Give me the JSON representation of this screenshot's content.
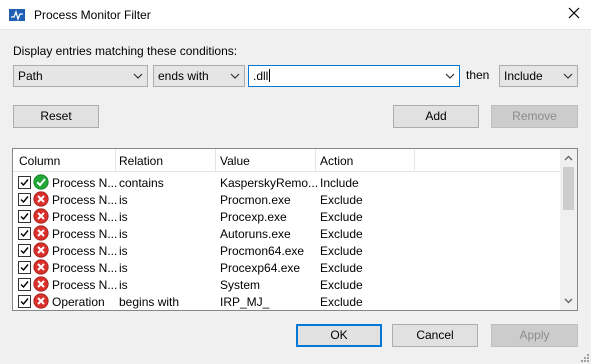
{
  "window": {
    "title": "Process Monitor Filter",
    "close_icon": "close-icon",
    "app_icon": "process-monitor-icon"
  },
  "condition": {
    "label": "Display entries matching these conditions:",
    "column_value": "Path",
    "relation_value": "ends with",
    "value_text": ".dll",
    "then_label": "then",
    "action_value": "Include"
  },
  "buttons": {
    "reset": "Reset",
    "add": "Add",
    "remove": "Remove",
    "ok": "OK",
    "cancel": "Cancel",
    "apply": "Apply"
  },
  "table": {
    "headers": [
      "Column",
      "Relation",
      "Value",
      "Action"
    ],
    "rows": [
      {
        "checked": true,
        "status": "include",
        "column": "Process N...",
        "relation": "contains",
        "value": "KasperskyRemo...",
        "action": "Include"
      },
      {
        "checked": true,
        "status": "exclude",
        "column": "Process N...",
        "relation": "is",
        "value": "Procmon.exe",
        "action": "Exclude"
      },
      {
        "checked": true,
        "status": "exclude",
        "column": "Process N...",
        "relation": "is",
        "value": "Procexp.exe",
        "action": "Exclude"
      },
      {
        "checked": true,
        "status": "exclude",
        "column": "Process N...",
        "relation": "is",
        "value": "Autoruns.exe",
        "action": "Exclude"
      },
      {
        "checked": true,
        "status": "exclude",
        "column": "Process N...",
        "relation": "is",
        "value": "Procmon64.exe",
        "action": "Exclude"
      },
      {
        "checked": true,
        "status": "exclude",
        "column": "Process N...",
        "relation": "is",
        "value": "Procexp64.exe",
        "action": "Exclude"
      },
      {
        "checked": true,
        "status": "exclude",
        "column": "Process N...",
        "relation": "is",
        "value": "System",
        "action": "Exclude"
      },
      {
        "checked": true,
        "status": "exclude",
        "column": "Operation",
        "relation": "begins with",
        "value": "IRP_MJ_",
        "action": "Exclude"
      }
    ]
  },
  "colors": {
    "include_green": "#22a836",
    "exclude_red": "#d9302c",
    "focus_blue": "#0078d7"
  }
}
